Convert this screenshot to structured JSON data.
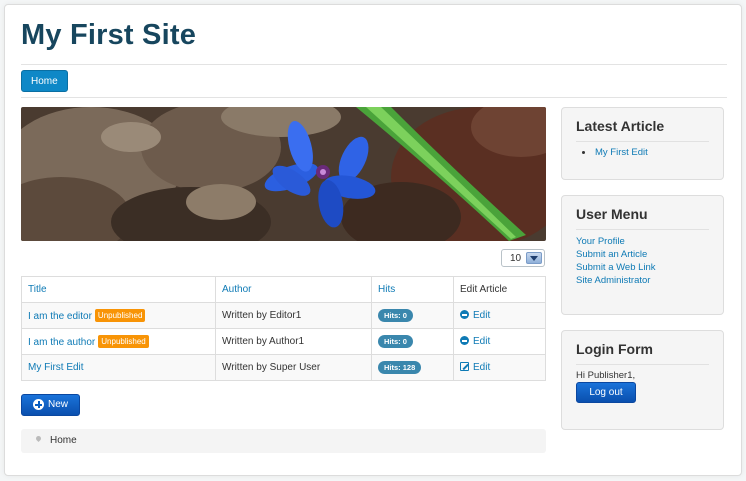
{
  "site": {
    "title": "My First Site"
  },
  "nav": {
    "home_label": "Home"
  },
  "hero": {
    "image": "blue-flower-photo"
  },
  "list_limit": {
    "value": "10"
  },
  "table": {
    "headers": {
      "title": "Title",
      "author": "Author",
      "hits": "Hits",
      "edit": "Edit Article"
    },
    "rows": [
      {
        "title": "I am the editor",
        "badge": "Unpublished",
        "author": "Written by Editor1",
        "hits": "Hits: 0",
        "edit": "Edit"
      },
      {
        "title": "I am the author",
        "badge": "Unpublished",
        "author": "Written by Author1",
        "hits": "Hits: 0",
        "edit": "Edit"
      },
      {
        "title": "My First Edit",
        "badge": "",
        "author": "Written by Super User",
        "hits": "Hits: 128",
        "edit": "Edit"
      }
    ]
  },
  "actions": {
    "new_label": "New"
  },
  "breadcrumb": {
    "home": "Home"
  },
  "sidebar": {
    "latest": {
      "title": "Latest Article",
      "items": [
        "My First Edit"
      ]
    },
    "user_menu": {
      "title": "User Menu",
      "items": [
        "Your Profile",
        "Submit an Article",
        "Submit a Web Link",
        "Site Administrator"
      ]
    },
    "login": {
      "title": "Login Form",
      "greeting": "Hi Publisher1,",
      "logout_label": "Log out"
    }
  },
  "colors": {
    "accent": "#0e88c7",
    "link": "#0e7ab5",
    "title": "#17465e",
    "unpublished": "#f89406",
    "hits": "#3a87ad"
  }
}
